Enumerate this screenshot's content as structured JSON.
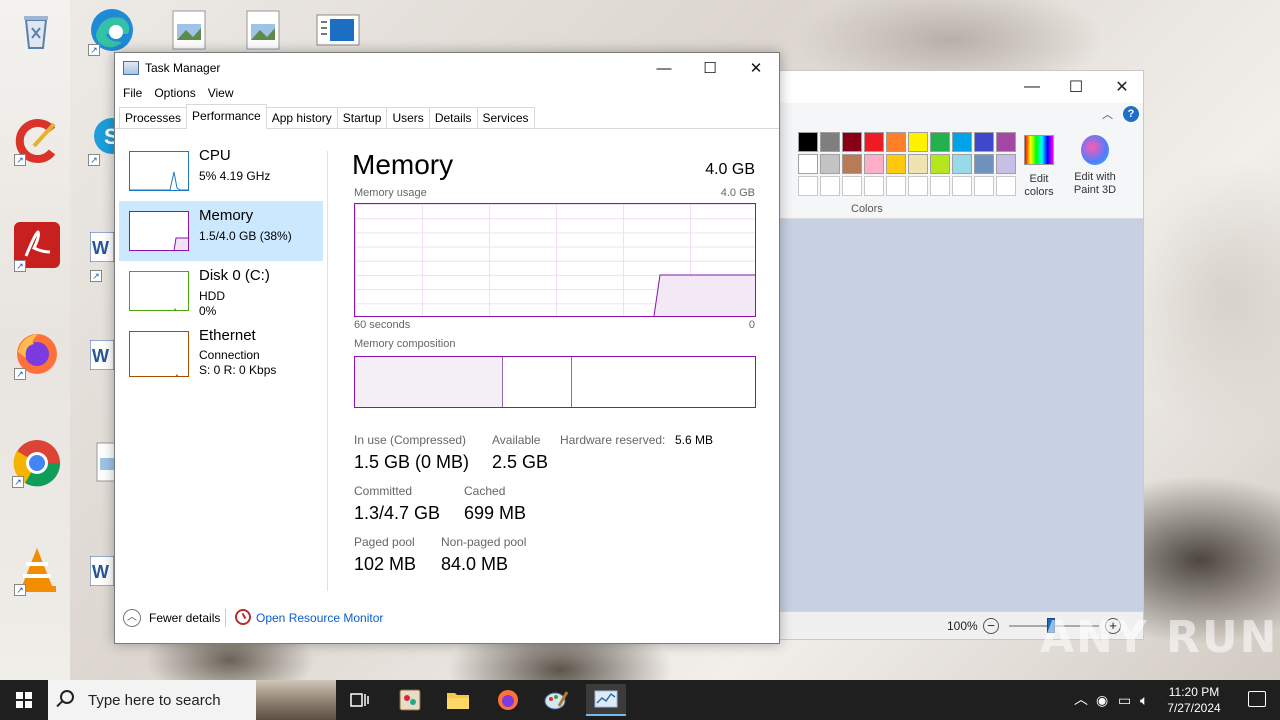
{
  "desktop": {
    "icons": [
      {
        "name": "recycle-bin",
        "color": "#5a7fb0"
      },
      {
        "name": "edge",
        "color": "#1f8ad6"
      },
      {
        "name": "ccleaner",
        "color": "#d9332a"
      },
      {
        "name": "skype",
        "color": "#1d9ddb"
      },
      {
        "name": "acrobat",
        "color": "#c8201e"
      },
      {
        "name": "word",
        "color": "#2b579a"
      },
      {
        "name": "firefox",
        "color": "#ff7139"
      },
      {
        "name": "chrome",
        "color": "#4285f4"
      },
      {
        "name": "vlc",
        "color": "#f28c00"
      }
    ],
    "watermark": "ANY RUN"
  },
  "paint": {
    "colors_group_label": "Colors",
    "color_label_fragment": "or",
    "edit_colors_label": "Edit colors",
    "edit_paint3d_label": "Edit with Paint 3D",
    "zoom_percent": "100%",
    "palette_row1": [
      "#000000",
      "#7f7f7f",
      "#880015",
      "#ed1c24",
      "#ff7f27",
      "#fff200",
      "#22b14c",
      "#00a2e8",
      "#3f48cc",
      "#a349a4"
    ],
    "palette_row2": [
      "#ffffff",
      "#c3c3c3",
      "#b97a57",
      "#ffaec9",
      "#ffc90e",
      "#efe4b0",
      "#b5e61d",
      "#99d9ea",
      "#7092be",
      "#c8bfe7"
    ],
    "palette_row3": [
      "#ffffff",
      "#ffffff",
      "#ffffff",
      "#ffffff",
      "#ffffff",
      "#ffffff",
      "#ffffff",
      "#ffffff",
      "#ffffff",
      "#ffffff"
    ]
  },
  "taskmgr": {
    "title": "Task Manager",
    "menu": [
      "File",
      "Options",
      "View"
    ],
    "tabs": [
      "Processes",
      "Performance",
      "App history",
      "Startup",
      "Users",
      "Details",
      "Services"
    ],
    "active_tab": "Performance",
    "sidebar": [
      {
        "name": "CPU",
        "line1": "5%  4.19 GHz",
        "line2": "",
        "color": "#1a78c2"
      },
      {
        "name": "Memory",
        "line1": "1.5/4.0 GB (38%)",
        "line2": "",
        "color": "#8b12ae"
      },
      {
        "name": "Disk 0 (C:)",
        "line1": "HDD",
        "line2": "0%",
        "color": "#4da60c"
      },
      {
        "name": "Ethernet",
        "line1": "Connection",
        "line2": "S: 0  R: 0 Kbps",
        "color": "#a74f01"
      }
    ],
    "main": {
      "title": "Memory",
      "total": "4.0 GB",
      "usage_label": "Memory usage",
      "usage_max": "4.0 GB",
      "time_label": "60 seconds",
      "time_zero": "0",
      "composition_label": "Memory composition",
      "stats": {
        "in_use_label": "In use (Compressed)",
        "in_use_value": "1.5 GB (0 MB)",
        "available_label": "Available",
        "available_value": "2.5 GB",
        "hw_reserved_label": "Hardware reserved:",
        "hw_reserved_value": "5.6 MB",
        "committed_label": "Committed",
        "committed_value": "1.3/4.7 GB",
        "cached_label": "Cached",
        "cached_value": "699 MB",
        "paged_label": "Paged pool",
        "paged_value": "102 MB",
        "nonpaged_label": "Non-paged pool",
        "nonpaged_value": "84.0 MB"
      }
    },
    "footer": {
      "fewer_details": "Fewer details",
      "open_resource_monitor": "Open Resource Monitor"
    }
  },
  "taskbar": {
    "search_placeholder": "Type here to search",
    "time": "11:20 PM",
    "date": "7/27/2024"
  }
}
